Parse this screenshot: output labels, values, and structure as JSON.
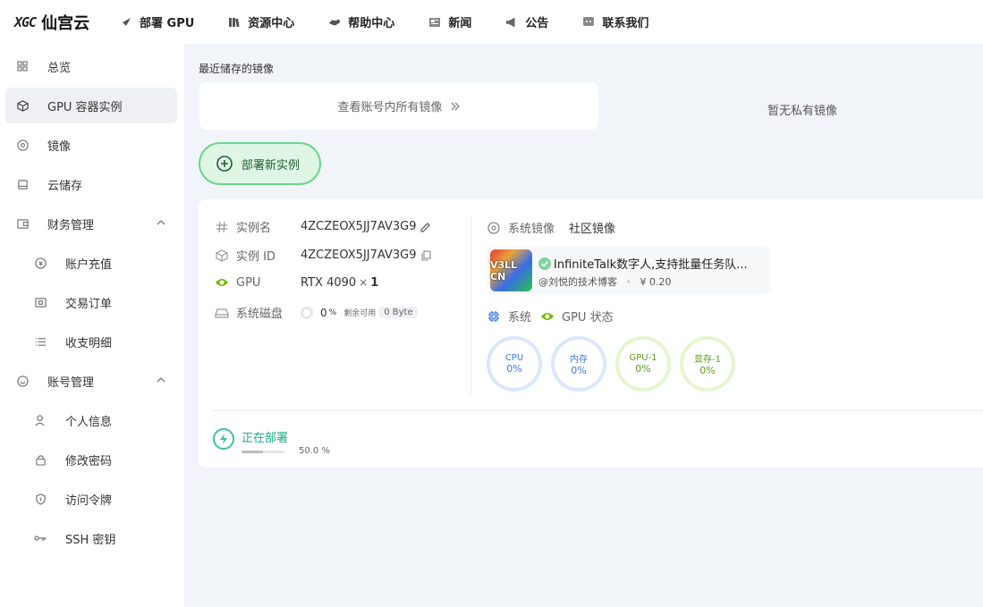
{
  "brand": {
    "mark": "XGC",
    "name": "仙宫云"
  },
  "nav": [
    {
      "label": "部署 GPU",
      "icon": "rocket-icon"
    },
    {
      "label": "资源中心",
      "icon": "books-icon"
    },
    {
      "label": "帮助中心",
      "icon": "handshake-icon"
    },
    {
      "label": "新闻",
      "icon": "newspaper-icon"
    },
    {
      "label": "公告",
      "icon": "megaphone-icon"
    },
    {
      "label": "联系我们",
      "icon": "chat-icon"
    }
  ],
  "sidebar": {
    "items": [
      {
        "label": "总览",
        "icon": "dashboard-icon"
      },
      {
        "label": "GPU 容器实例",
        "icon": "cube-icon",
        "active": true
      },
      {
        "label": "镜像",
        "icon": "disc-icon"
      },
      {
        "label": "云储存",
        "icon": "storage-icon"
      },
      {
        "label": "财务管理",
        "icon": "wallet-icon",
        "expandable": true
      },
      {
        "label": "账户充值",
        "icon": "recharge-icon",
        "sub": true
      },
      {
        "label": "交易订单",
        "icon": "order-icon",
        "sub": true
      },
      {
        "label": "收支明细",
        "icon": "list-icon",
        "sub": true
      },
      {
        "label": "账号管理",
        "icon": "smile-icon",
        "expandable": true
      },
      {
        "label": "个人信息",
        "icon": "user-icon",
        "sub": true
      },
      {
        "label": "修改密码",
        "icon": "lock-icon",
        "sub": true
      },
      {
        "label": "访问令牌",
        "icon": "shield-icon",
        "sub": true
      },
      {
        "label": "SSH 密钥",
        "icon": "key-icon",
        "sub": true
      }
    ]
  },
  "recent": {
    "title": "最近储存的镜像",
    "view_all": "查看账号内所有镜像",
    "no_private": "暂无私有镜像"
  },
  "deploy_button": "部署新实例",
  "instance": {
    "name_label": "实例名",
    "name_value": "4ZCZEOX5JJ7AV3G9",
    "id_label": "实例 ID",
    "id_value": "4ZCZEOX5JJ7AV3G9",
    "gpu_label": "GPU",
    "gpu_model": "RTX 4090",
    "gpu_times": "×",
    "gpu_count": "1",
    "disk_label": "系统磁盘",
    "disk_percent": "0",
    "disk_unit": "%",
    "disk_free_label": "剩余可用",
    "disk_free_value": "0 Byte",
    "sys_image_label": "系统镜像",
    "sys_image_value": "社区镜像",
    "image_thumb_text": "V3LL CN",
    "image_title": "InfiniteTalk数字人,支持批量任务队...",
    "image_author": "@刘悦的技术博客",
    "image_sep": "•",
    "image_price": "¥ 0.20",
    "sys_label": "系统",
    "gpu_status_label": "GPU 状态",
    "meters": [
      {
        "label": "CPU",
        "value": "0%",
        "tone": "blue"
      },
      {
        "label": "内存",
        "value": "0%",
        "tone": "blue"
      },
      {
        "label": "GPU-1",
        "value": "0%",
        "tone": "green"
      },
      {
        "label": "显存-1",
        "value": "0%",
        "tone": "green"
      }
    ],
    "status_text": "正在部署",
    "progress_label": "50.0 %",
    "progress_value": 0.5
  },
  "colors": {
    "accent_green": "#6bd68c",
    "status_teal": "#1daa86",
    "nvidia_green": "#76b900"
  }
}
